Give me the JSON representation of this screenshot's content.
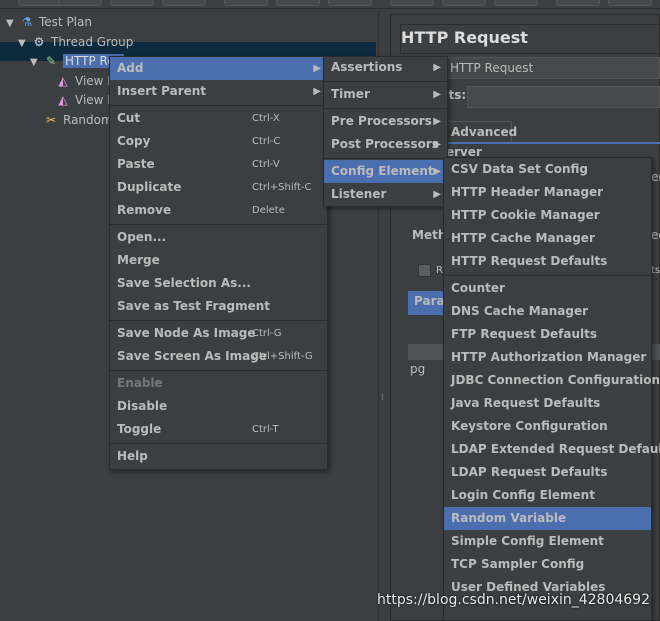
{
  "tree": [
    {
      "label": "Test Plan",
      "icon": "flask-icon",
      "level": 0,
      "expanded": true
    },
    {
      "label": "Thread Group",
      "icon": "gear-icon",
      "level": 1,
      "expanded": true
    },
    {
      "label": "HTTP Request",
      "visible_label": "HTTP Req",
      "icon": "pipette-icon",
      "level": 2,
      "expanded": true,
      "selected": true
    },
    {
      "label": "View Re",
      "icon": "listener-icon",
      "level": 3
    },
    {
      "label": "View Re",
      "icon": "listener-icon",
      "level": 3
    },
    {
      "label": "Random V",
      "icon": "wrench-icon",
      "level": 2
    }
  ],
  "panel": {
    "title": "HTTP Request",
    "name_value": "HTTP Request",
    "comments_label": "nts:",
    "tab_advanced": "Advanced",
    "server_label": "erver",
    "method_label": "Metho",
    "params_tab": "Paran",
    "cell": "pg",
    "right_edge_1": "er",
    "right_edge_2": "ed",
    "right_edge_3": "ts",
    "checkbox_label": "R"
  },
  "context_menu": [
    {
      "label": "Add",
      "submenu": true,
      "highlighted": true
    },
    {
      "label": "Insert Parent",
      "submenu": true
    },
    {
      "sep": true
    },
    {
      "label": "Cut",
      "shortcut": "Ctrl-X"
    },
    {
      "label": "Copy",
      "shortcut": "Ctrl-C"
    },
    {
      "label": "Paste",
      "shortcut": "Ctrl-V"
    },
    {
      "label": "Duplicate",
      "shortcut": "Ctrl+Shift-C"
    },
    {
      "label": "Remove",
      "shortcut": "Delete"
    },
    {
      "sep": true
    },
    {
      "label": "Open..."
    },
    {
      "label": "Merge"
    },
    {
      "label": "Save Selection As..."
    },
    {
      "label": "Save as Test Fragment"
    },
    {
      "sep": true
    },
    {
      "label": "Save Node As Image",
      "shortcut": "Ctrl-G"
    },
    {
      "label": "Save Screen As Image",
      "shortcut": "Ctrl+Shift-G"
    },
    {
      "sep": true
    },
    {
      "label": "Enable",
      "disabled": true
    },
    {
      "label": "Disable"
    },
    {
      "label": "Toggle",
      "shortcut": "Ctrl-T"
    },
    {
      "sep": true
    },
    {
      "label": "Help"
    }
  ],
  "add_menu": [
    {
      "label": "Assertions",
      "submenu": true
    },
    {
      "sep": true
    },
    {
      "label": "Timer",
      "submenu": true
    },
    {
      "sep": true
    },
    {
      "label": "Pre Processors",
      "submenu": true
    },
    {
      "label": "Post Processors",
      "submenu": true
    },
    {
      "sep": true
    },
    {
      "label": "Config Element",
      "submenu": true,
      "highlighted": true
    },
    {
      "label": "Listener",
      "submenu": true
    }
  ],
  "config_menu": [
    {
      "label": "CSV Data Set Config"
    },
    {
      "label": "HTTP Header Manager"
    },
    {
      "label": "HTTP Cookie Manager"
    },
    {
      "label": "HTTP Cache Manager"
    },
    {
      "label": "HTTP Request Defaults"
    },
    {
      "sep": true
    },
    {
      "label": "Counter"
    },
    {
      "label": "DNS Cache Manager"
    },
    {
      "label": "FTP Request Defaults"
    },
    {
      "label": "HTTP Authorization Manager"
    },
    {
      "label": "JDBC Connection Configuration"
    },
    {
      "label": "Java Request Defaults"
    },
    {
      "label": "Keystore Configuration"
    },
    {
      "label": "LDAP Extended Request Defaults"
    },
    {
      "label": "LDAP Request Defaults"
    },
    {
      "label": "Login Config Element"
    },
    {
      "label": "Random Variable",
      "highlighted": true
    },
    {
      "label": "Simple Config Element"
    },
    {
      "label": "TCP Sampler Config"
    },
    {
      "label": "User Defined Variables"
    }
  ],
  "watermark": "https://blog.csdn.net/weixin_42804692",
  "colors": {
    "background": "#3c3f41",
    "highlight": "#4b6eaf",
    "text": "#bbbbbb",
    "tree_selection": "#0d293e"
  }
}
